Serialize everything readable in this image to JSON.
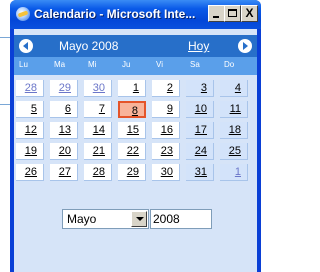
{
  "window": {
    "title": "Calendario - Microsoft Inte..."
  },
  "title_buttons": {
    "minimize": "_",
    "maximize": "□",
    "close": "X"
  },
  "calendar": {
    "month_label": "Mayo 2008",
    "today_link": "Hoy",
    "weekdays": [
      "Lu",
      "Ma",
      "Mi",
      "Ju",
      "Vi",
      "Sa",
      "Do"
    ],
    "weeks": [
      [
        "28",
        "29",
        "30",
        "1",
        "2",
        "3",
        "4"
      ],
      [
        "5",
        "6",
        "7",
        "8",
        "9",
        "10",
        "11"
      ],
      [
        "12",
        "13",
        "14",
        "15",
        "16",
        "17",
        "18"
      ],
      [
        "19",
        "20",
        "21",
        "22",
        "23",
        "24",
        "25"
      ],
      [
        "26",
        "27",
        "28",
        "29",
        "30",
        "31",
        "1"
      ]
    ],
    "selected_day": "8"
  },
  "footer": {
    "month_select": "Mayo",
    "year_input": "2008"
  },
  "colors": {
    "header": "#276fc9",
    "dow": "#5a9fea",
    "today": "#f8b39a",
    "other_month": "#6b76c9"
  }
}
